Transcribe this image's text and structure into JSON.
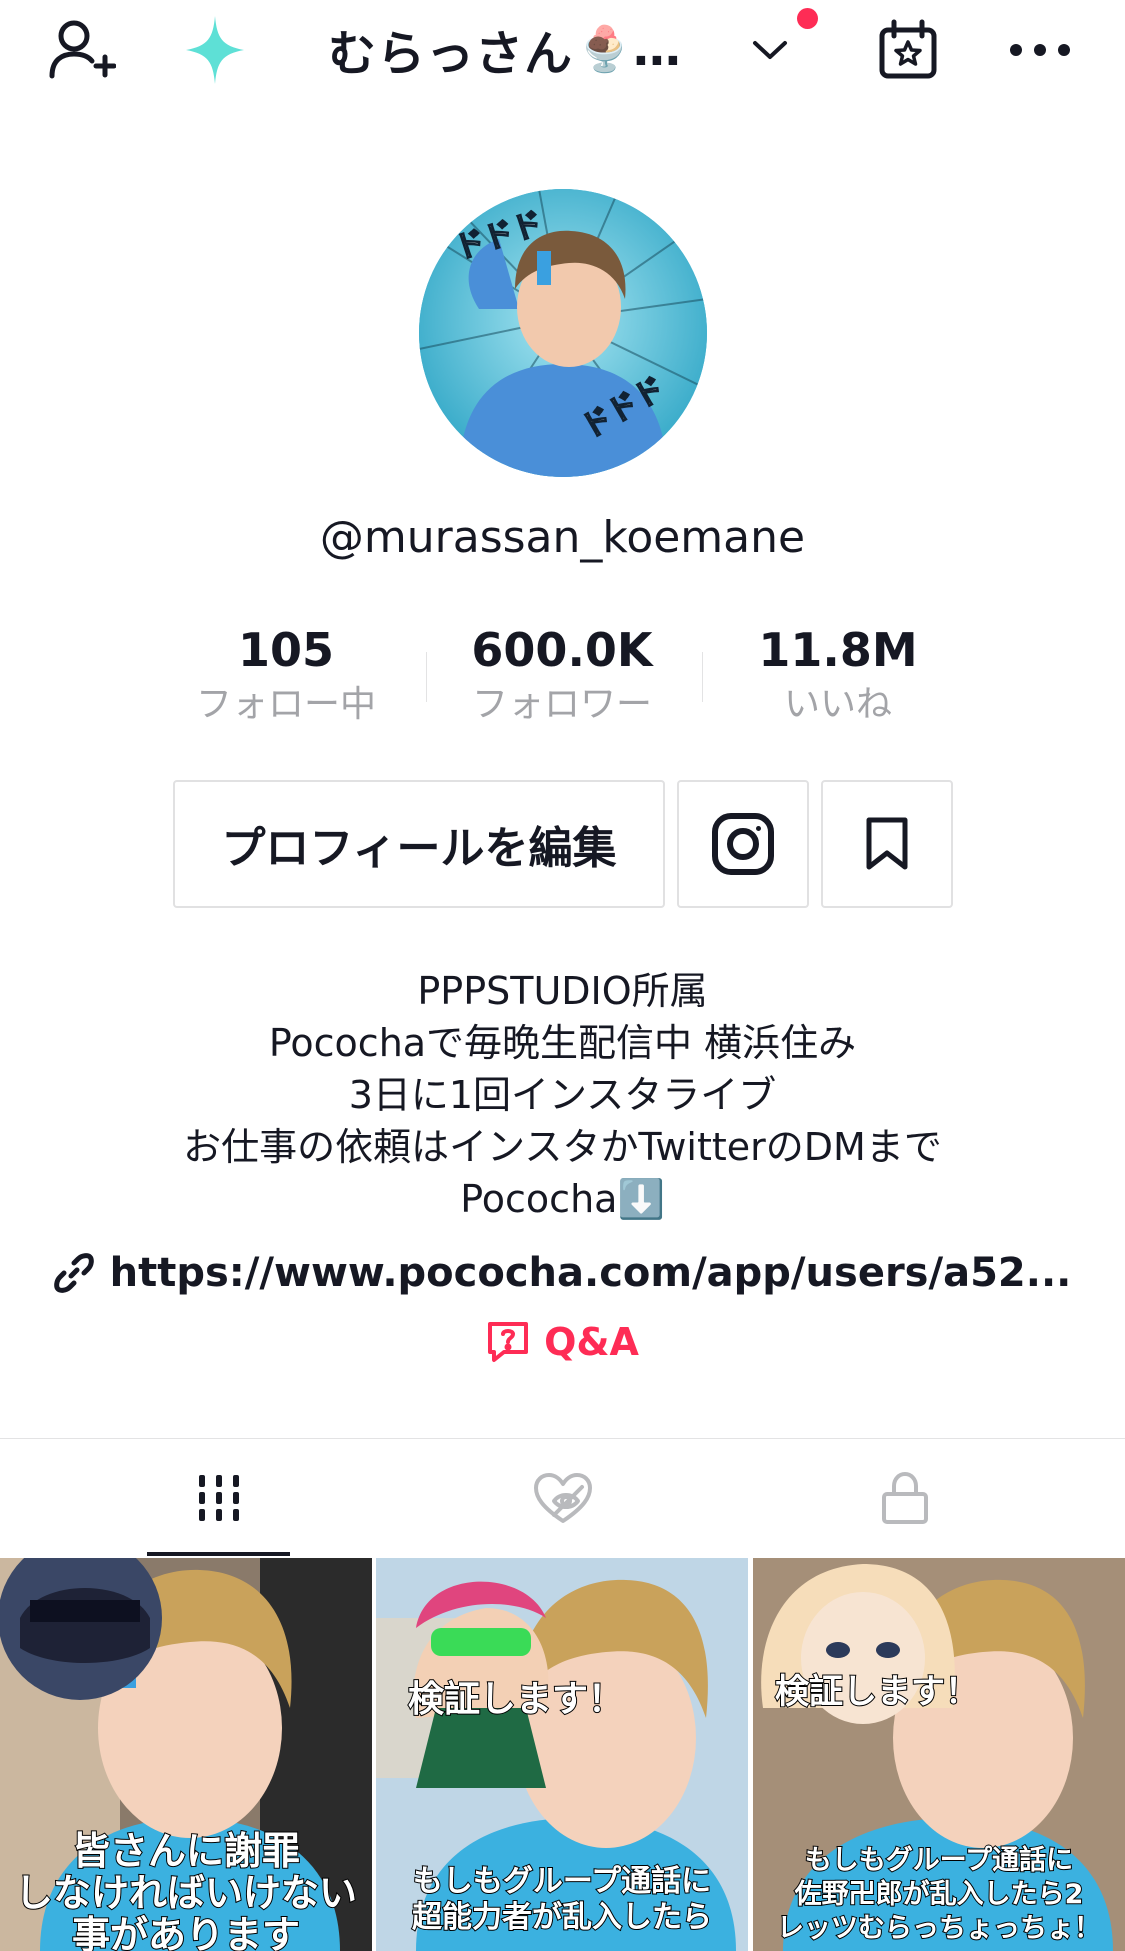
{
  "header": {
    "title": "むらっさん",
    "title_emoji": "🍨",
    "title_ellipsis": "…"
  },
  "profile": {
    "handle": "@murassan_koemane"
  },
  "stats": [
    {
      "value": "105",
      "label": "フォロー中"
    },
    {
      "value": "600.0K",
      "label": "フォロワー"
    },
    {
      "value": "11.8M",
      "label": "いいね"
    }
  ],
  "actions": {
    "edit_label": "プロフィールを編集"
  },
  "bio": {
    "lines": [
      "PPPSTUDIO所属",
      "Pocochaで毎晩生配信中 横浜住み",
      "3日に1回インスタライブ",
      "お仕事の依頼はインスタかTwitterのDMまで",
      "Pococha⬇️"
    ]
  },
  "link": {
    "text": "https://www.pococha.com/app/users/a52..."
  },
  "qa": {
    "label": "Q&A"
  },
  "videos": [
    {
      "caption_lines": [
        "皆さんに謝罪",
        "しなければいけない",
        "事があります"
      ]
    },
    {
      "top_caption": "検証します！",
      "caption_lines": [
        "もしもグループ通話に",
        "超能力者が乱入したら"
      ]
    },
    {
      "top_caption": "検証します！",
      "caption_lines": [
        "もしもグループ通話に",
        "佐野卍郎が乱入したら2",
        "レッツむらっちょっちょ！"
      ]
    }
  ],
  "colors": {
    "accent": "#fe2c55",
    "text": "#161823",
    "muted": "#a3a4a8",
    "sparkle": "#5ee0d6"
  }
}
